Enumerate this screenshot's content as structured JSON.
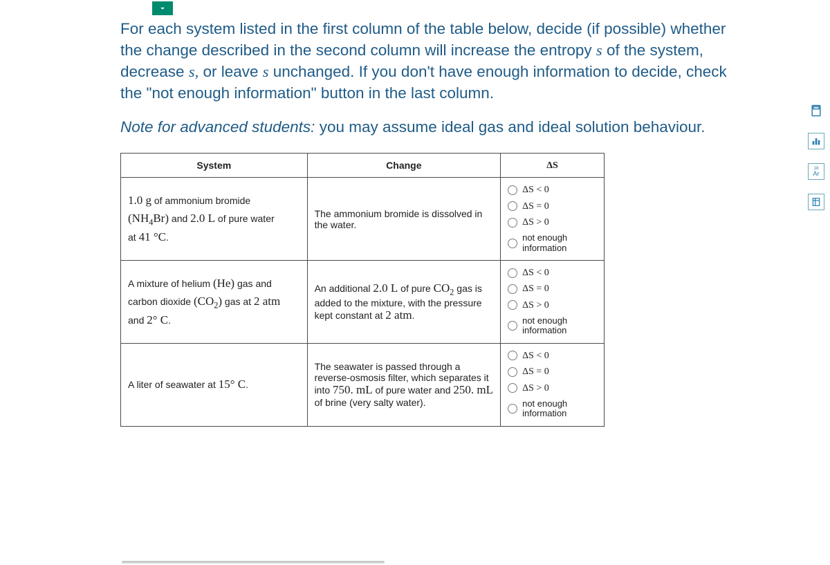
{
  "instructions": {
    "text_a": "For each system listed in the first column of the table below, decide (if possible) whether the change described in the second column will increase the entropy ",
    "s1": "s",
    "text_b": " of the system, decrease ",
    "s2": "s,",
    "text_c": " or leave ",
    "s3": "s",
    "text_d": " unchanged. If you don't have enough information to decide, check the \"not enough information\" button in the last column."
  },
  "note": {
    "emph": "Note for advanced students:",
    "rest": " you may assume ideal gas and ideal solution behaviour."
  },
  "headers": {
    "system": "System",
    "change": "Change",
    "ds": "ΔS"
  },
  "options_labels": {
    "lt": "ΔS < 0",
    "eq": "ΔS = 0",
    "gt": "ΔS > 0",
    "ni": "not enough information"
  },
  "rows": [
    {
      "system": {
        "l1a": "1.0 g",
        "l1b": " of ammonium bromide",
        "l2a": "(NH",
        "l2sub": "4",
        "l2b": "Br)",
        "l2c": " and ",
        "l2d": "2.0 L",
        "l2e": " of pure water",
        "l3a": "at ",
        "l3b": "41 °C",
        "l3c": "."
      },
      "change": "The ammonium bromide is dissolved in the water."
    },
    {
      "system": {
        "l1a": "A mixture of helium ",
        "l1b": "(He)",
        "l1c": " gas and",
        "l2a": "carbon dioxide ",
        "l2b": "(CO",
        "l2sub": "2",
        "l2c": ")",
        "l2d": " gas at ",
        "l2e": "2 atm",
        "l3a": "and ",
        "l3b": "2° C",
        "l3c": "."
      },
      "change": {
        "a": "An additional ",
        "b": "2.0 L",
        "c": " of pure ",
        "d": "CO",
        "dsub": "2",
        "e": " gas is added to the mixture, with the pressure kept constant at ",
        "f": "2 atm",
        "g": "."
      }
    },
    {
      "system": {
        "l1a": "A liter of seawater at ",
        "l1b": "15° C",
        "l1c": "."
      },
      "change": {
        "a": "The seawater is passed through a reverse-osmosis filter, which separates it into ",
        "b": "750. mL",
        "c": " of pure water and ",
        "d": "250. mL",
        "e": " of brine (very salty water)."
      }
    }
  ]
}
